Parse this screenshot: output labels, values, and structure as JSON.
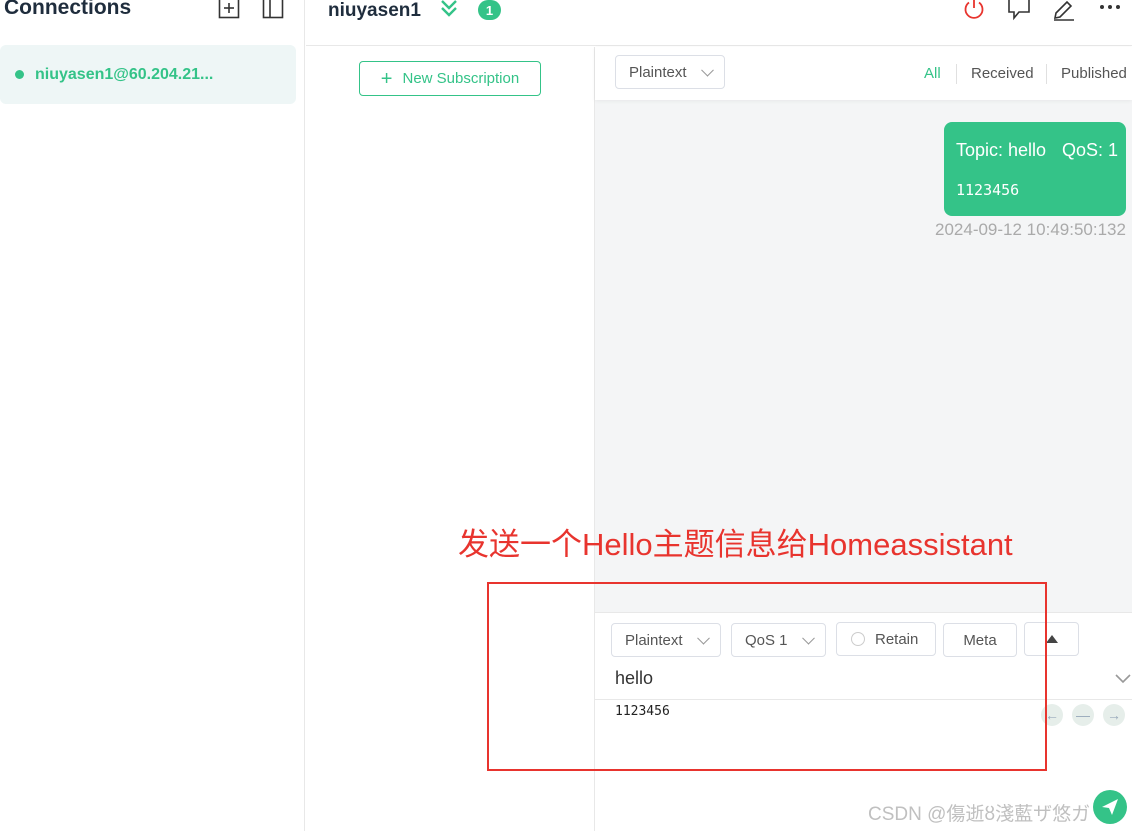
{
  "sidebar": {
    "title": "Connections",
    "connection": {
      "label": "niuyasen1@60.204.21...",
      "status_color": "#34c388"
    }
  },
  "topbar": {
    "connection_name": "niuyasen1",
    "badge_count": "1"
  },
  "subscriptions": {
    "new_label": "New Subscription"
  },
  "messages": {
    "format_select": "Plaintext",
    "filters": {
      "all": "All",
      "received": "Received",
      "published": "Published"
    },
    "items": [
      {
        "topic": "Topic: hello",
        "qos": "QoS: 1",
        "payload": "1123456",
        "time": "2024-09-12 10:49:50:132"
      }
    ]
  },
  "publish": {
    "format": "Plaintext",
    "qos": "QoS 1",
    "retain": "Retain",
    "meta": "Meta",
    "topic": "hello",
    "payload": "1123456"
  },
  "annotation": {
    "text": "发送一个Hello主题信息给Homeassistant",
    "color": "#e8342e"
  },
  "watermark": "CSDN @傷逝ȣ淺藍ザ悠ガ",
  "colors": {
    "accent": "#34c388",
    "danger": "#e8342e"
  },
  "icons": [
    "add-connection-icon",
    "layout-icon",
    "expand-icon",
    "power-icon",
    "chat-icon",
    "edit-icon",
    "more-icon",
    "plus-icon",
    "send-icon"
  ]
}
